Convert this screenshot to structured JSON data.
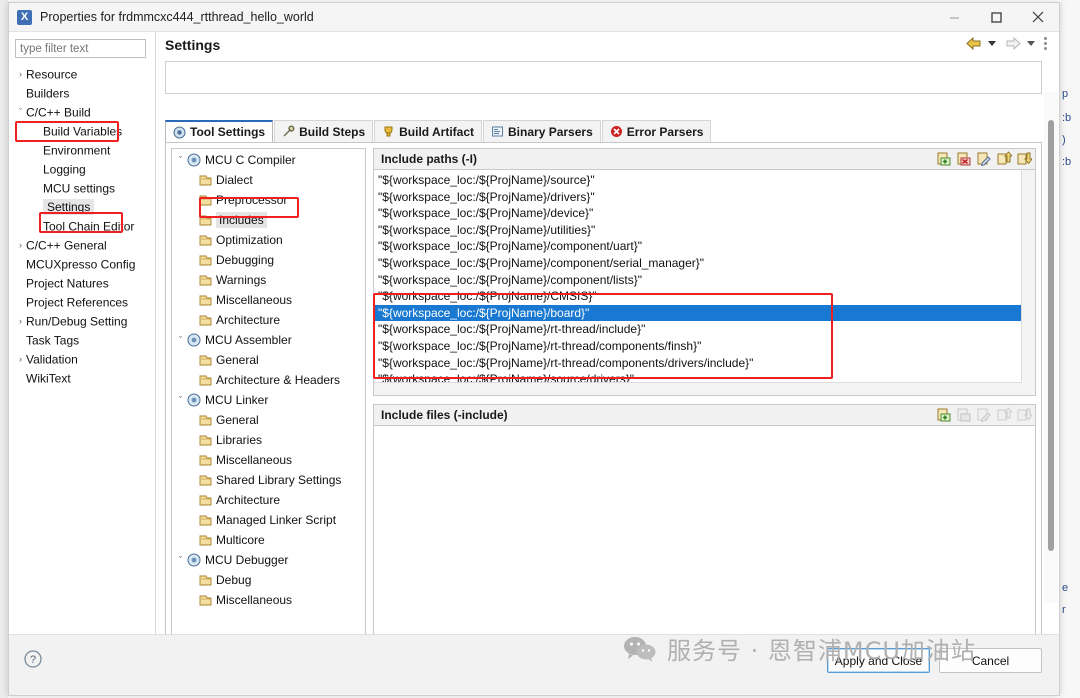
{
  "window": {
    "title": "Properties for frdmmcxc444_rtthread_hello_world",
    "icon": "eclipse-x-icon",
    "minimize": "minimize-icon",
    "maximize": "maximize-icon",
    "close": "close-icon"
  },
  "sidebar": {
    "filter_placeholder": "type filter text",
    "filter_value": "",
    "items": [
      {
        "label": "Resource",
        "depth": 1,
        "arrow": "collapsed",
        "selected": false
      },
      {
        "label": "Builders",
        "depth": 1,
        "arrow": "none",
        "selected": false
      },
      {
        "label": "C/C++ Build",
        "depth": 1,
        "arrow": "expanded",
        "selected": false,
        "highlight": true
      },
      {
        "label": "Build Variables",
        "depth": 2,
        "arrow": "none",
        "selected": false
      },
      {
        "label": "Environment",
        "depth": 2,
        "arrow": "none",
        "selected": false
      },
      {
        "label": "Logging",
        "depth": 2,
        "arrow": "none",
        "selected": false
      },
      {
        "label": "MCU settings",
        "depth": 2,
        "arrow": "none",
        "selected": false
      },
      {
        "label": "Settings",
        "depth": 2,
        "arrow": "none",
        "selected": true,
        "highlight": true
      },
      {
        "label": "Tool Chain Editor",
        "depth": 2,
        "arrow": "none",
        "selected": false
      },
      {
        "label": "C/C++ General",
        "depth": 1,
        "arrow": "collapsed",
        "selected": false
      },
      {
        "label": "MCUXpresso Config",
        "depth": 1,
        "arrow": "none",
        "selected": false
      },
      {
        "label": "Project Natures",
        "depth": 1,
        "arrow": "none",
        "selected": false
      },
      {
        "label": "Project References",
        "depth": 1,
        "arrow": "none",
        "selected": false
      },
      {
        "label": "Run/Debug Setting",
        "depth": 1,
        "arrow": "collapsed",
        "selected": false
      },
      {
        "label": "Task Tags",
        "depth": 1,
        "arrow": "none",
        "selected": false
      },
      {
        "label": "Validation",
        "depth": 1,
        "arrow": "collapsed",
        "selected": false
      },
      {
        "label": "WikiText",
        "depth": 1,
        "arrow": "none",
        "selected": false
      }
    ]
  },
  "pane": {
    "title": "Settings",
    "nav_back": "back-arrow-icon",
    "nav_forward": "forward-arrow-icon",
    "menu": "view-menu-icon"
  },
  "tabs": [
    {
      "label": "Tool Settings",
      "icon": "tool-settings-icon",
      "active": true
    },
    {
      "label": "Build Steps",
      "icon": "build-steps-icon",
      "active": false
    },
    {
      "label": "Build Artifact",
      "icon": "build-artifact-icon",
      "active": false
    },
    {
      "label": "Binary Parsers",
      "icon": "binary-parsers-icon",
      "active": false
    },
    {
      "label": "Error Parsers",
      "icon": "error-parsers-icon",
      "active": false
    }
  ],
  "tool_tree": [
    {
      "label": "MCU C Compiler",
      "level": 1,
      "arrow": "expanded",
      "icon": "tool-icon",
      "selected": false
    },
    {
      "label": "Dialect",
      "level": 2,
      "arrow": "none",
      "icon": "page-icon",
      "selected": false
    },
    {
      "label": "Preprocessor",
      "level": 2,
      "arrow": "none",
      "icon": "page-icon",
      "selected": false
    },
    {
      "label": "Includes",
      "level": 2,
      "arrow": "none",
      "icon": "page-icon",
      "selected": true,
      "highlight": true
    },
    {
      "label": "Optimization",
      "level": 2,
      "arrow": "none",
      "icon": "page-icon",
      "selected": false
    },
    {
      "label": "Debugging",
      "level": 2,
      "arrow": "none",
      "icon": "page-icon",
      "selected": false
    },
    {
      "label": "Warnings",
      "level": 2,
      "arrow": "none",
      "icon": "page-icon",
      "selected": false
    },
    {
      "label": "Miscellaneous",
      "level": 2,
      "arrow": "none",
      "icon": "page-icon",
      "selected": false
    },
    {
      "label": "Architecture",
      "level": 2,
      "arrow": "none",
      "icon": "page-icon",
      "selected": false
    },
    {
      "label": "MCU Assembler",
      "level": 1,
      "arrow": "expanded",
      "icon": "tool-icon",
      "selected": false
    },
    {
      "label": "General",
      "level": 2,
      "arrow": "none",
      "icon": "page-icon",
      "selected": false
    },
    {
      "label": "Architecture & Headers",
      "level": 2,
      "arrow": "none",
      "icon": "page-icon",
      "selected": false
    },
    {
      "label": "MCU Linker",
      "level": 1,
      "arrow": "expanded",
      "icon": "tool-icon",
      "selected": false
    },
    {
      "label": "General",
      "level": 2,
      "arrow": "none",
      "icon": "page-icon",
      "selected": false
    },
    {
      "label": "Libraries",
      "level": 2,
      "arrow": "none",
      "icon": "page-icon",
      "selected": false
    },
    {
      "label": "Miscellaneous",
      "level": 2,
      "arrow": "none",
      "icon": "page-icon",
      "selected": false
    },
    {
      "label": "Shared Library Settings",
      "level": 2,
      "arrow": "none",
      "icon": "page-icon",
      "selected": false
    },
    {
      "label": "Architecture",
      "level": 2,
      "arrow": "none",
      "icon": "page-icon",
      "selected": false
    },
    {
      "label": "Managed Linker Script",
      "level": 2,
      "arrow": "none",
      "icon": "page-icon",
      "selected": false
    },
    {
      "label": "Multicore",
      "level": 2,
      "arrow": "none",
      "icon": "page-icon",
      "selected": false
    },
    {
      "label": "MCU Debugger",
      "level": 1,
      "arrow": "expanded",
      "icon": "tool-icon",
      "selected": false
    },
    {
      "label": "Debug",
      "level": 2,
      "arrow": "none",
      "icon": "page-icon",
      "selected": false
    },
    {
      "label": "Miscellaneous",
      "level": 2,
      "arrow": "none",
      "icon": "page-icon",
      "selected": false
    }
  ],
  "include_paths": {
    "header": "Include paths (-I)",
    "toolbar": [
      "add-icon",
      "delete-icon",
      "edit-icon",
      "move-up-icon",
      "move-down-icon"
    ],
    "entries": [
      {
        "value": "\"${workspace_loc:/${ProjName}/source}\"",
        "selected": false
      },
      {
        "value": "\"${workspace_loc:/${ProjName}/drivers}\"",
        "selected": false
      },
      {
        "value": "\"${workspace_loc:/${ProjName}/device}\"",
        "selected": false
      },
      {
        "value": "\"${workspace_loc:/${ProjName}/utilities}\"",
        "selected": false
      },
      {
        "value": "\"${workspace_loc:/${ProjName}/component/uart}\"",
        "selected": false
      },
      {
        "value": "\"${workspace_loc:/${ProjName}/component/serial_manager}\"",
        "selected": false
      },
      {
        "value": "\"${workspace_loc:/${ProjName}/component/lists}\"",
        "selected": false
      },
      {
        "value": "\"${workspace_loc:/${ProjName}/CMSIS}\"",
        "selected": false
      },
      {
        "value": "\"${workspace_loc:/${ProjName}/board}\"",
        "selected": true
      },
      {
        "value": "\"${workspace_loc:/${ProjName}/rt-thread/include}\"",
        "selected": false
      },
      {
        "value": "\"${workspace_loc:/${ProjName}/rt-thread/components/finsh}\"",
        "selected": false
      },
      {
        "value": "\"${workspace_loc:/${ProjName}/rt-thread/components/drivers/include}\"",
        "selected": false
      },
      {
        "value": "\"${workspace_loc:/${ProjName}/source/drivers}\"",
        "selected": false
      }
    ]
  },
  "include_files": {
    "header": "Include files (-include)",
    "toolbar": [
      "add-icon",
      "delete-icon",
      "edit-icon",
      "move-up-icon",
      "move-down-icon"
    ],
    "entries": []
  },
  "footer": {
    "help": "help-icon",
    "apply_label": "Apply and Close",
    "cancel_label": "Cancel"
  },
  "watermark": {
    "icon": "wechat-icon",
    "text": "服务号 · 恩智浦MCU加油站"
  },
  "colors": {
    "selection_blue": "#1878d2",
    "highlight_red": "#ee2020",
    "tab_accent": "#2b6cb8"
  },
  "background_text": [
    "p",
    "b",
    ")",
    "b",
    "e",
    "r"
  ]
}
